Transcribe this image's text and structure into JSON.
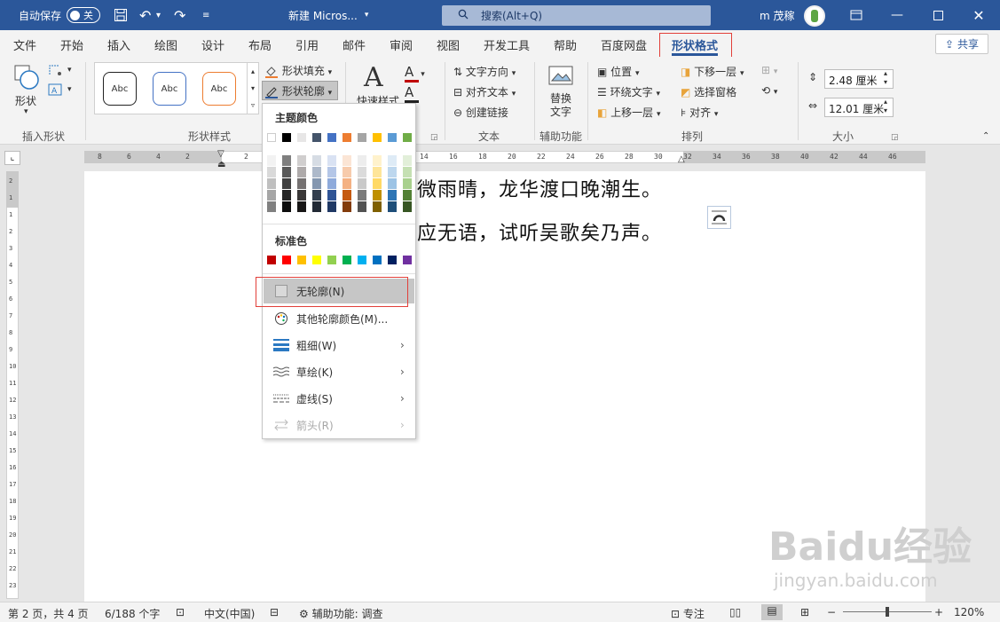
{
  "titlebar": {
    "autosave_label": "自动保存",
    "autosave_state": "关",
    "doc_title": "新建 Micros...",
    "search_placeholder": "搜索(Alt+Q)",
    "user_name": "m 茂稼"
  },
  "tabs": [
    "文件",
    "开始",
    "插入",
    "绘图",
    "设计",
    "布局",
    "引用",
    "邮件",
    "审阅",
    "视图",
    "开发工具",
    "帮助",
    "百度网盘",
    "形状格式"
  ],
  "active_tab": "形状格式",
  "share_label": "共享",
  "ribbon": {
    "insert_shapes": {
      "shape_label": "形状",
      "group_label": "插入形状"
    },
    "shape_styles": {
      "style_samples": [
        "Abc",
        "Abc",
        "Abc"
      ],
      "fill_label": "形状填充",
      "outline_label": "形状轮廓",
      "group_label": "形状样式"
    },
    "wordart": {
      "quick_styles_label": "快速样式"
    },
    "text": {
      "direction_label": "文字方向",
      "align_label": "对齐文本",
      "link_label": "创建链接",
      "group_label": "文本"
    },
    "accessibility": {
      "alt_text_label": "替换\n文字",
      "group_label": "辅助功能"
    },
    "arrange": {
      "position_label": "位置",
      "wrap_label": "环绕文字",
      "forward_label": "上移一层",
      "backward_label": "下移一层",
      "selection_pane_label": "选择窗格",
      "align_label": "对齐",
      "group_label": "排列"
    },
    "size": {
      "height_value": "2.48 厘米",
      "width_value": "12.01 厘米",
      "group_label": "大小"
    }
  },
  "ruler": {
    "h_ticks": [
      "8",
      "6",
      "4",
      "2",
      "",
      "2",
      "4",
      "6",
      "8",
      "10",
      "12",
      "14",
      "16",
      "18",
      "20",
      "22",
      "24",
      "26",
      "28",
      "30",
      "32",
      "34",
      "36",
      "38",
      "40",
      "42",
      "44",
      "46"
    ],
    "v_ticks": [
      "2",
      "1",
      "1",
      "2",
      "3",
      "4",
      "5",
      "6",
      "7",
      "8",
      "9",
      "10",
      "11",
      "12",
      "13",
      "14",
      "15",
      "16",
      "17",
      "18",
      "19",
      "20",
      "21",
      "22",
      "23"
    ]
  },
  "document": {
    "line1": "微雨晴，龙华渡口晚潮生。",
    "line2": "应无语，试听吴歌矣乃声。"
  },
  "dropdown": {
    "theme_colors_label": "主题颜色",
    "standard_colors_label": "标准色",
    "theme_top_row": [
      "#ffffff",
      "#000000",
      "#e7e6e6",
      "#44546a",
      "#4472c4",
      "#ed7d31",
      "#a5a5a5",
      "#ffc000",
      "#5b9bd5",
      "#70ad47"
    ],
    "theme_shade_columns": [
      [
        "#f2f2f2",
        "#d9d9d9",
        "#bfbfbf",
        "#a6a6a6",
        "#808080"
      ],
      [
        "#7f7f7f",
        "#595959",
        "#404040",
        "#262626",
        "#0d0d0d"
      ],
      [
        "#d0cece",
        "#aeaaaa",
        "#757171",
        "#3a3838",
        "#171616"
      ],
      [
        "#d6dce4",
        "#adb9ca",
        "#8497b0",
        "#333f4f",
        "#222a35"
      ],
      [
        "#d9e2f3",
        "#b4c6e7",
        "#8eaadb",
        "#2f5496",
        "#1f3864"
      ],
      [
        "#fbe5d5",
        "#f7cbac",
        "#f4b183",
        "#c55a11",
        "#833c0b"
      ],
      [
        "#ededed",
        "#dbdbdb",
        "#c9c9c9",
        "#7b7b7b",
        "#525252"
      ],
      [
        "#fff2cc",
        "#fee599",
        "#ffd965",
        "#bf9000",
        "#7f6000"
      ],
      [
        "#deebf6",
        "#bdd7ee",
        "#9cc3e5",
        "#2e75b5",
        "#1e4e79"
      ],
      [
        "#e2efd9",
        "#c5e0b3",
        "#a8d08d",
        "#538135",
        "#375623"
      ]
    ],
    "standard_colors": [
      "#c00000",
      "#ff0000",
      "#ffc000",
      "#ffff00",
      "#92d050",
      "#00b050",
      "#00b0f0",
      "#0070c0",
      "#002060",
      "#7030a0"
    ],
    "no_outline_label": "无轮廓(N)",
    "more_colors_label": "其他轮廓颜色(M)...",
    "weight_label": "粗细(W)",
    "sketched_label": "草绘(K)",
    "dashes_label": "虚线(S)",
    "arrows_label": "箭头(R)"
  },
  "statusbar": {
    "page_info": "第 2 页，共 4 页",
    "word_count": "6/188 个字",
    "language": "中文(中国)",
    "accessibility": "辅助功能: 调查",
    "focus_label": "专注",
    "zoom_level": 0.5,
    "zoom_percent": "120%"
  },
  "watermark": {
    "brand": "Baidu经验",
    "url": "jingyan.baidu.com"
  }
}
